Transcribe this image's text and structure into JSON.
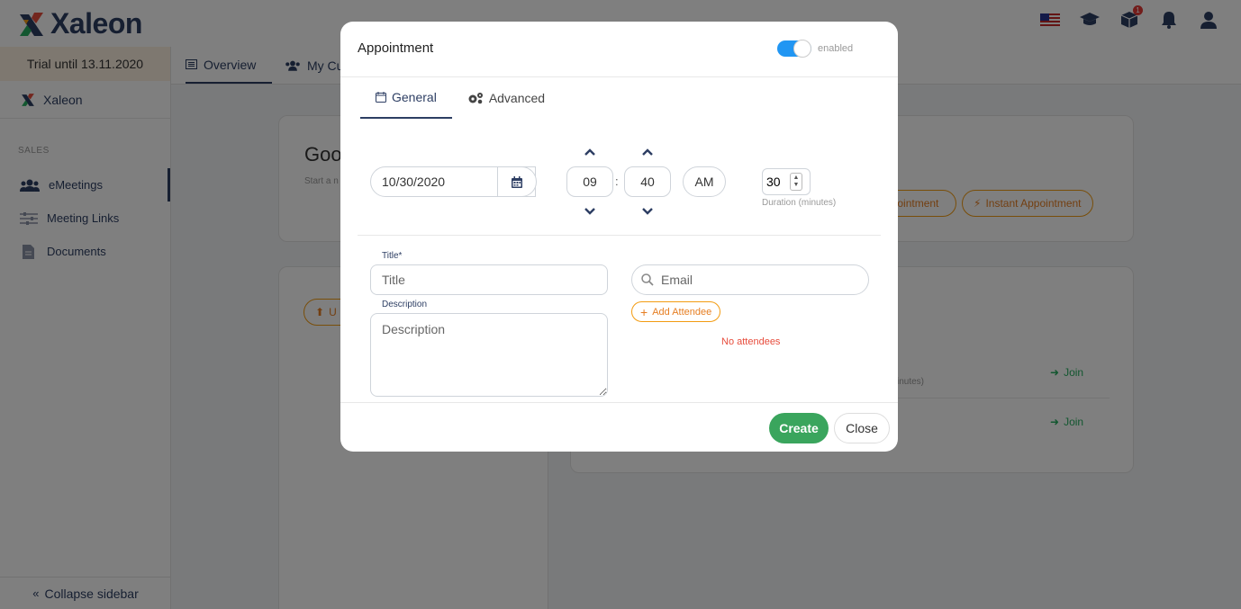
{
  "app": {
    "logo_text": "Xaleon",
    "trial_text": "Trial until 13.11.2020",
    "brand_name": "Xaleon",
    "section_label": "SALES",
    "nav": [
      {
        "label": "eMeetings",
        "icon": "users-icon"
      },
      {
        "label": "Meeting Links",
        "icon": "sliders-icon"
      },
      {
        "label": "Documents",
        "icon": "document-icon"
      }
    ],
    "collapse_label": "Collapse sidebar",
    "tabs": [
      {
        "label": "Overview",
        "icon": "list-icon"
      },
      {
        "label": "My Cu",
        "icon": "users-icon"
      }
    ],
    "greeting": "Goo",
    "greeting_sub": "Start a n",
    "appointment_button": "ppointment",
    "instant_button": "Instant Appointment",
    "upload_button": "U",
    "minutes_fragment": "inutes)",
    "join_label": "Join",
    "notification_count": "1",
    "accent_color": "#2d3e63",
    "orange_color": "#e67e22"
  },
  "modal": {
    "title": "Appointment",
    "toggle_label": "enabled",
    "toggle_on": true,
    "tabs": [
      {
        "label": "General",
        "icon": "calendar-icon"
      },
      {
        "label": "Advanced",
        "icon": "gears-icon"
      }
    ],
    "date_value": "10/30/2020",
    "hour_value": "09",
    "minute_value": "40",
    "colon": ":",
    "ampm_label": "AM",
    "duration_value": "30",
    "duration_label": "Duration (minutes)",
    "title_label": "Title*",
    "title_placeholder": "Title",
    "description_label": "Description",
    "description_placeholder": "Description",
    "email_placeholder": "Email",
    "add_attendee_label": "Add Attendee",
    "no_attendees_text": "No attendees",
    "create_label": "Create",
    "close_label": "Close",
    "create_color": "#3aa55d",
    "error_color": "#e74c3c"
  }
}
